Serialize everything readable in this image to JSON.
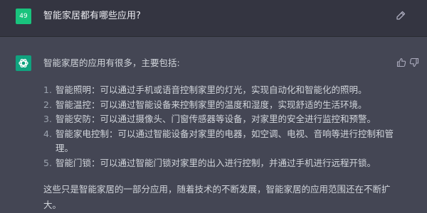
{
  "user_message": {
    "avatar_label": "49",
    "text": "智能家居都有哪些应用?"
  },
  "assistant_message": {
    "intro": "智能家居的应用有很多，主要包括:",
    "items": [
      {
        "num": "1.",
        "text": "智能照明：可以通过手机或语音控制家里的灯光，实现自动化和智能化的照明。"
      },
      {
        "num": "2.",
        "text": "智能温控：可以通过智能设备来控制家里的温度和湿度，实现舒适的生活环境。"
      },
      {
        "num": "3.",
        "text": "智能安防：可以通过摄像头、门窗传感器等设备，对家里的安全进行监控和预警。"
      },
      {
        "num": "4.",
        "text": "智能家电控制：可以通过智能设备对家里的电器，如空调、电视、音响等进行控制和管理。"
      },
      {
        "num": "5.",
        "text": "智能门锁：可以通过智能门锁对家里的出入进行控制，并通过手机进行远程开锁。"
      }
    ],
    "outro": "这些只是智能家居的一部分应用，随着技术的不断发展，智能家居的应用范围还在不断扩大。"
  },
  "icons": {
    "edit": "edit-icon",
    "thumbs_up": "thumbs-up-icon",
    "thumbs_down": "thumbs-down-icon",
    "assistant_logo": "openai-logo-icon"
  },
  "colors": {
    "user_avatar": "#19c37d",
    "assistant_avatar": "#10a37f",
    "user_row_bg": "#343541",
    "assistant_row_bg": "#444654"
  }
}
